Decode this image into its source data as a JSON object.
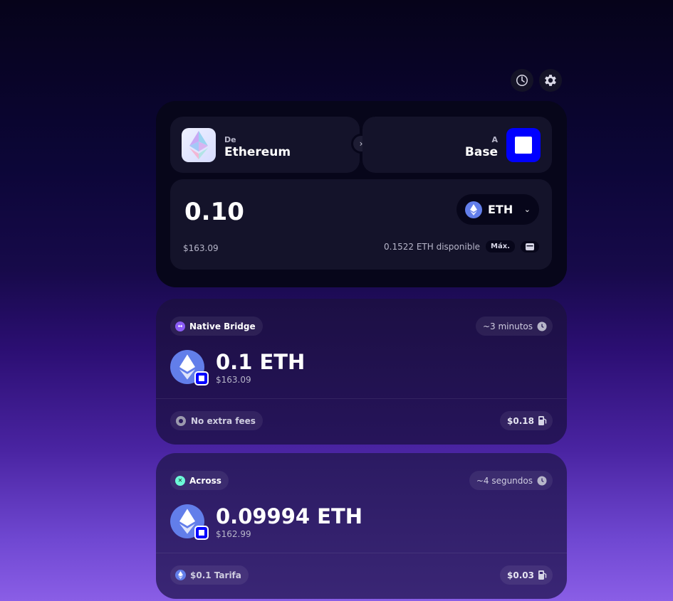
{
  "header": {
    "history_icon": "clock-icon",
    "settings_icon": "gear-icon"
  },
  "transfer": {
    "from_label": "De",
    "from_network": "Ethereum",
    "to_label": "A",
    "to_network": "Base",
    "amount": "0.10",
    "token": "ETH",
    "usd_value": "$163.09",
    "balance": "0.1522 ETH disponible",
    "max_label": "Máx."
  },
  "routes": [
    {
      "provider": "Native Bridge",
      "time": "~3 minutos",
      "amount": "0.1 ETH",
      "usd": "$163.09",
      "fee_text": "No extra fees",
      "gas": "$0.18"
    },
    {
      "provider": "Across",
      "time": "~4 segundos",
      "amount": "0.09994 ETH",
      "usd": "$162.99",
      "fee_text": "$0.1 Tarifa",
      "gas": "$0.03"
    }
  ],
  "colors": {
    "eth": "#627eea",
    "base": "#0000ff",
    "native_bridge": "#8b5cf6",
    "across": "#6cf9d8"
  }
}
